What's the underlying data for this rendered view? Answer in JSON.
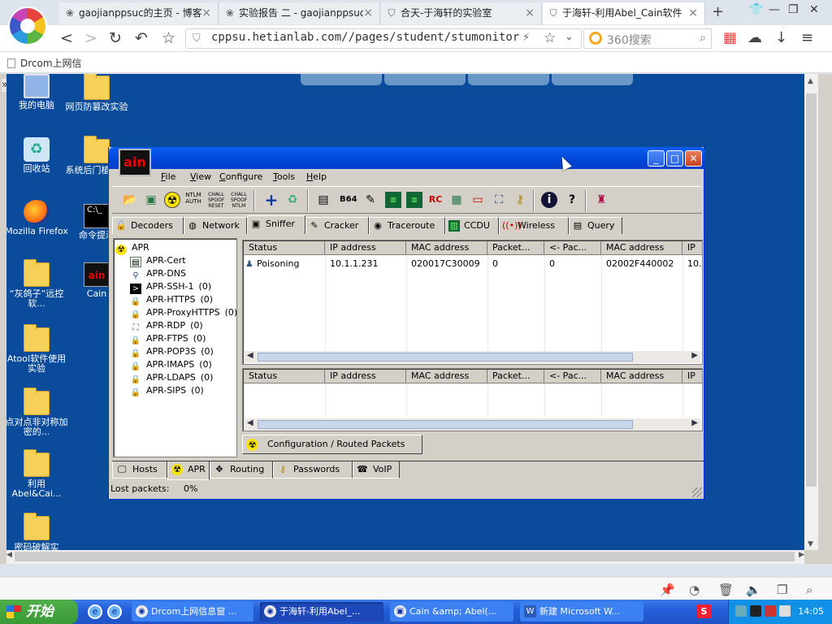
{
  "browser": {
    "tabs": [
      {
        "label": "gaojianppsuc的主页 - 博客",
        "icon": "paw-icon",
        "active": false
      },
      {
        "label": "实验报告 二 - gaojianppsuc",
        "icon": "paw-icon",
        "active": false
      },
      {
        "label": "合天-于海轩的实验室",
        "icon": "shield-icon",
        "active": false
      },
      {
        "label": "于海轩-利用Abel_Cain软件",
        "icon": "shield-icon",
        "active": true
      }
    ],
    "url": "cppsu.hetianlab.com//pages/student/stumonitor.js",
    "search_placeholder": "360搜索",
    "bookmark": "Drcom上网信"
  },
  "desktop": {
    "icons": [
      {
        "label": "我的电脑",
        "kind": "computer"
      },
      {
        "label": "网页防篡改实验",
        "kind": "folder"
      },
      {
        "label": "回收站",
        "kind": "recycle"
      },
      {
        "label": "系统后门植实验",
        "kind": "folder"
      },
      {
        "label": "Mozilla Firefox",
        "kind": "firefox"
      },
      {
        "label": "命令提示",
        "kind": "cmd"
      },
      {
        "label": "“灰鸽子”远控软...",
        "kind": "folder"
      },
      {
        "label": "Cain",
        "kind": "cain"
      },
      {
        "label": "Atool软件使用实验",
        "kind": "folder"
      },
      {
        "label": "点对点非对称加密的...",
        "kind": "folder"
      },
      {
        "label": "利用Abel&Cai...",
        "kind": "folder"
      },
      {
        "label": "密码破解实",
        "kind": "folder"
      }
    ]
  },
  "cain": {
    "logo": "ain",
    "menu": [
      "File",
      "View",
      "Configure",
      "Tools",
      "Help"
    ],
    "toolbar_labels": {
      "ntlm": "NTLM\nAUTH",
      "chall1": "CHALL\nSPOOF\nRESET",
      "chall2": "CHALL\nSPOOF\nNTLM",
      "b64": "B64"
    },
    "tabs": [
      "Decoders",
      "Network",
      "Sniffer",
      "Cracker",
      "Traceroute",
      "CCDU",
      "Wireless",
      "Query"
    ],
    "selected_tab": "Sniffer",
    "tree": [
      {
        "label": "APR",
        "count": ""
      },
      {
        "label": "APR-Cert",
        "count": ""
      },
      {
        "label": "APR-DNS",
        "count": ""
      },
      {
        "label": "APR-SSH-1",
        "count": "(0)"
      },
      {
        "label": "APR-HTTPS",
        "count": "(0)"
      },
      {
        "label": "APR-ProxyHTTPS",
        "count": "(0)"
      },
      {
        "label": "APR-RDP",
        "count": "(0)"
      },
      {
        "label": "APR-FTPS",
        "count": "(0)"
      },
      {
        "label": "APR-POP3S",
        "count": "(0)"
      },
      {
        "label": "APR-IMAPS",
        "count": "(0)"
      },
      {
        "label": "APR-LDAPS",
        "count": "(0)"
      },
      {
        "label": "APR-SIPS",
        "count": "(0)"
      }
    ],
    "top_columns": [
      "Status",
      "IP address",
      "MAC address",
      "Packet...",
      "<- Pac...",
      "MAC address",
      "IP"
    ],
    "top_rows": [
      {
        "status": "Poisoning",
        "ip": "10.1.1.231",
        "mac": "020017C30009",
        "packets": "0",
        "packets_back": "0",
        "mac2": "02002F440002",
        "ip2": "10."
      }
    ],
    "bottom_columns": [
      "Status",
      "IP address",
      "MAC address",
      "Packet...",
      "<- Pac...",
      "MAC address",
      "IP"
    ],
    "config_tab": "Configuration / Routed Packets",
    "bottom_tabs": [
      "Hosts",
      "APR",
      "Routing",
      "Passwords",
      "VoIP"
    ],
    "selected_bottom_tab": "APR",
    "status_label": "Lost packets:",
    "status_value": "0%"
  },
  "taskbar": {
    "start": "开始",
    "tasks": [
      {
        "label": "Drcom上网信息窗 ...",
        "active": false
      },
      {
        "label": "于海轩-利用Abel_...",
        "active": true
      },
      {
        "label": "Cain &amp; Abel(...",
        "active": false
      },
      {
        "label": "新建 Microsoft W...",
        "active": false
      }
    ],
    "clock": "14:05"
  }
}
